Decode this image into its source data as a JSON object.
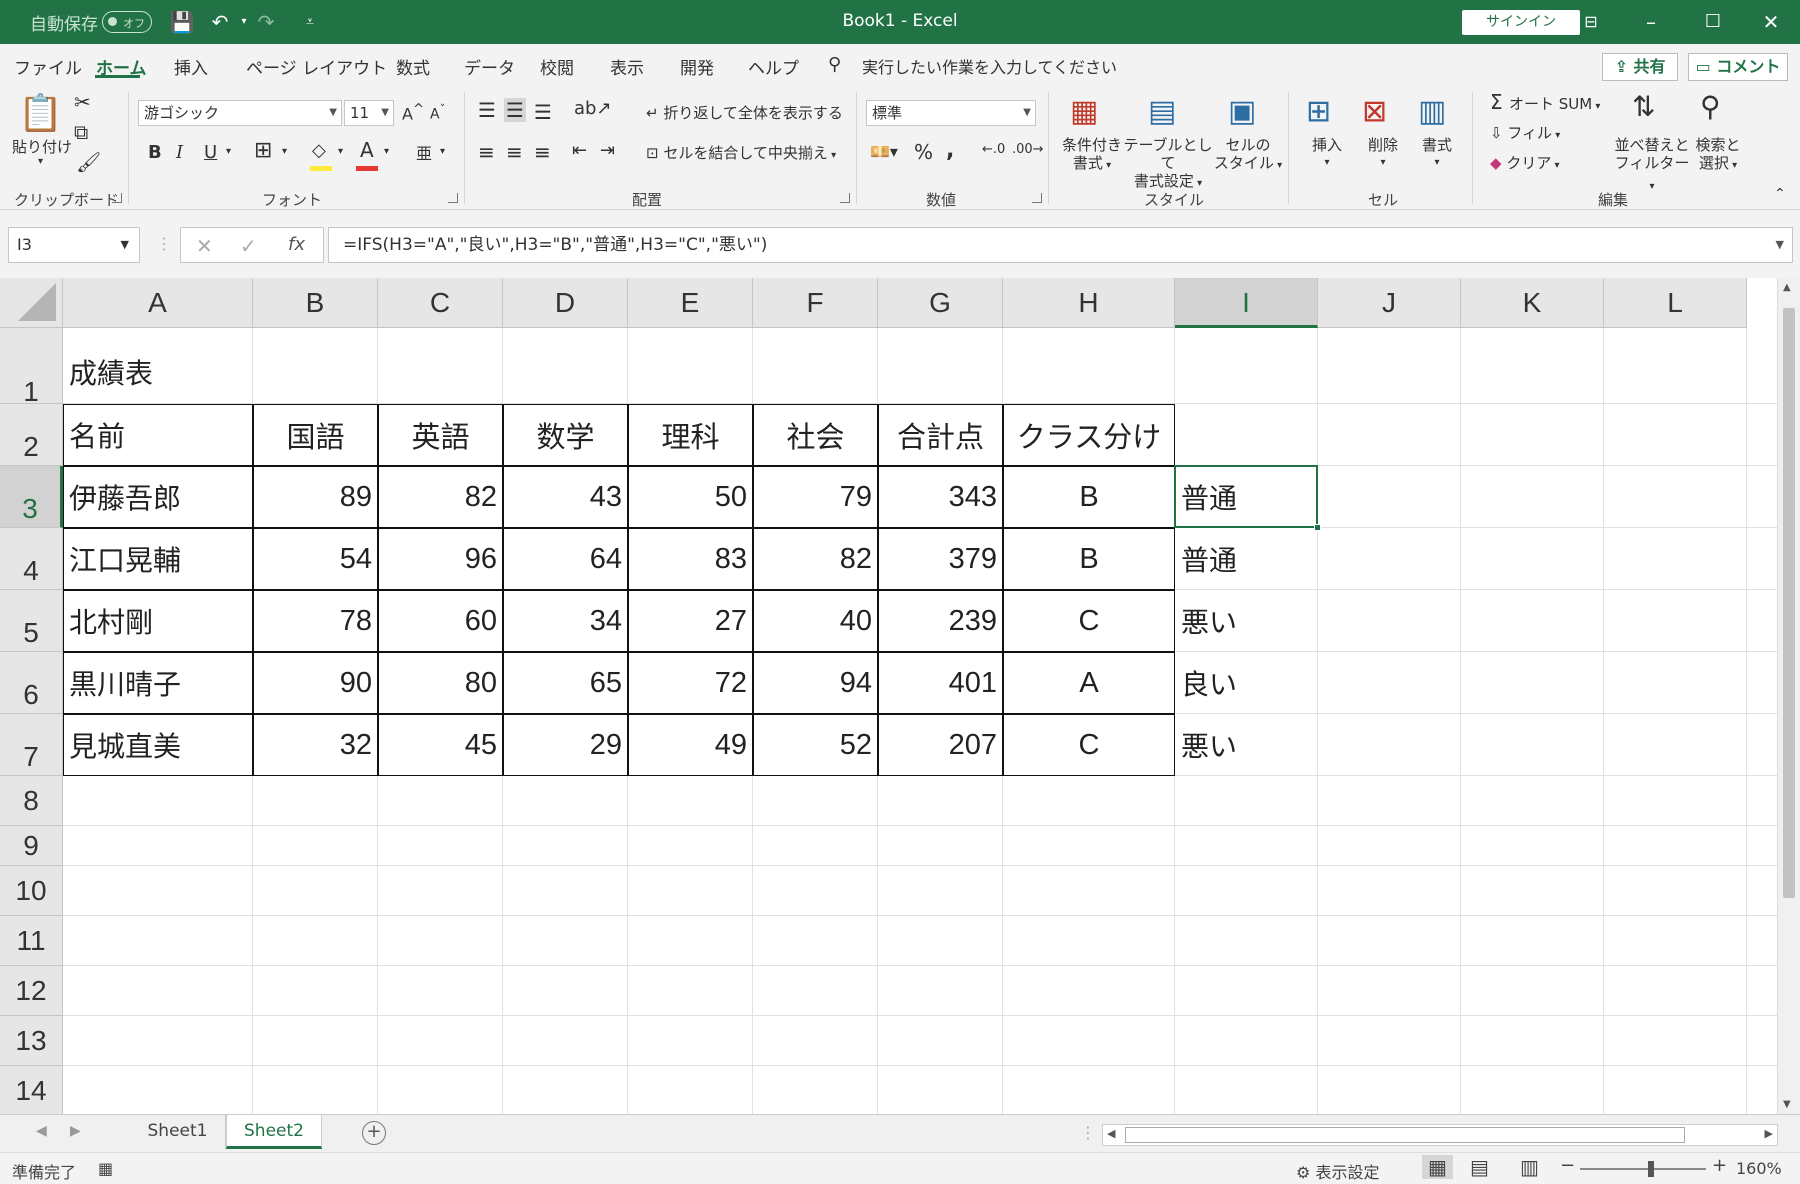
{
  "titlebar": {
    "autosave_label": "自動保存",
    "autosave_state": "オフ",
    "title": "Book1  -  Excel",
    "signin": "サインイン"
  },
  "menu": {
    "tabs": [
      "ファイル",
      "ホーム",
      "挿入",
      "ページ レイアウト",
      "数式",
      "データ",
      "校閲",
      "表示",
      "開発",
      "ヘルプ"
    ],
    "active_tab": "ホーム",
    "tell_me": "実行したい作業を入力してください",
    "share": "共有",
    "comment": "コメント"
  },
  "ribbon": {
    "clipboard": {
      "label": "クリップボード",
      "paste": "貼り付け"
    },
    "font": {
      "label": "フォント",
      "name": "游ゴシック",
      "size": "11"
    },
    "alignment": {
      "label": "配置",
      "wrap": "折り返して全体を表示する",
      "merge": "セルを結合して中央揃え"
    },
    "number": {
      "label": "数値",
      "format": "標準"
    },
    "styles": {
      "label": "スタイル",
      "cond_format": [
        "条件付き",
        "書式"
      ],
      "table_format": [
        "テーブルとして",
        "書式設定"
      ],
      "cell_styles": [
        "セルの",
        "スタイル"
      ]
    },
    "cells": {
      "label": "セル",
      "insert": "挿入",
      "delete": "削除",
      "format": "書式"
    },
    "editing": {
      "label": "編集",
      "autosum": "オート SUM",
      "fill": "フィル",
      "clear": "クリア",
      "sort": [
        "並べ替えと",
        "フィルター"
      ],
      "find": [
        "検索と",
        "選択"
      ]
    }
  },
  "formula_bar": {
    "name_box": "I3",
    "formula": "=IFS(H3=\"A\",\"良い\",H3=\"B\",\"普通\",H3=\"C\",\"悪い\")",
    "fx": "fx"
  },
  "sheet": {
    "columns": [
      "A",
      "B",
      "C",
      "D",
      "E",
      "F",
      "G",
      "H",
      "I",
      "J",
      "K",
      "L"
    ],
    "selected_column": "I",
    "rows": [
      "1",
      "2",
      "3",
      "4",
      "5",
      "6",
      "7",
      "8",
      "9",
      "10",
      "11",
      "12",
      "13",
      "14"
    ],
    "selected_row": "3",
    "active_cell": "I3",
    "title": "成績表",
    "headers": [
      "名前",
      "国語",
      "英語",
      "数学",
      "理科",
      "社会",
      "合計点",
      "クラス分け"
    ],
    "data": [
      [
        "伊藤吾郎",
        "89",
        "82",
        "43",
        "50",
        "79",
        "343",
        "B",
        "普通"
      ],
      [
        "江口晃輔",
        "54",
        "96",
        "64",
        "83",
        "82",
        "379",
        "B",
        "普通"
      ],
      [
        "北村剛",
        "78",
        "60",
        "34",
        "27",
        "40",
        "239",
        "C",
        "悪い"
      ],
      [
        "黒川晴子",
        "90",
        "80",
        "65",
        "72",
        "94",
        "401",
        "A",
        "良い"
      ],
      [
        "見城直美",
        "32",
        "45",
        "29",
        "49",
        "52",
        "207",
        "C",
        "悪い"
      ]
    ]
  },
  "sheet_tabs": {
    "tabs": [
      "Sheet1",
      "Sheet2"
    ],
    "active": "Sheet2"
  },
  "status": {
    "ready": "準備完了",
    "display_settings": "表示設定",
    "zoom": "160%"
  },
  "colors": {
    "accent": "#217346",
    "grid_line": "#e1e1e1",
    "header_bg": "#e6e6e6"
  },
  "icons": [
    "save-icon",
    "undo-icon",
    "redo-icon",
    "paste-icon",
    "cut-icon",
    "copy-icon",
    "format-painter-icon",
    "search-icon",
    "sum-icon",
    "sort-filter-icon"
  ]
}
